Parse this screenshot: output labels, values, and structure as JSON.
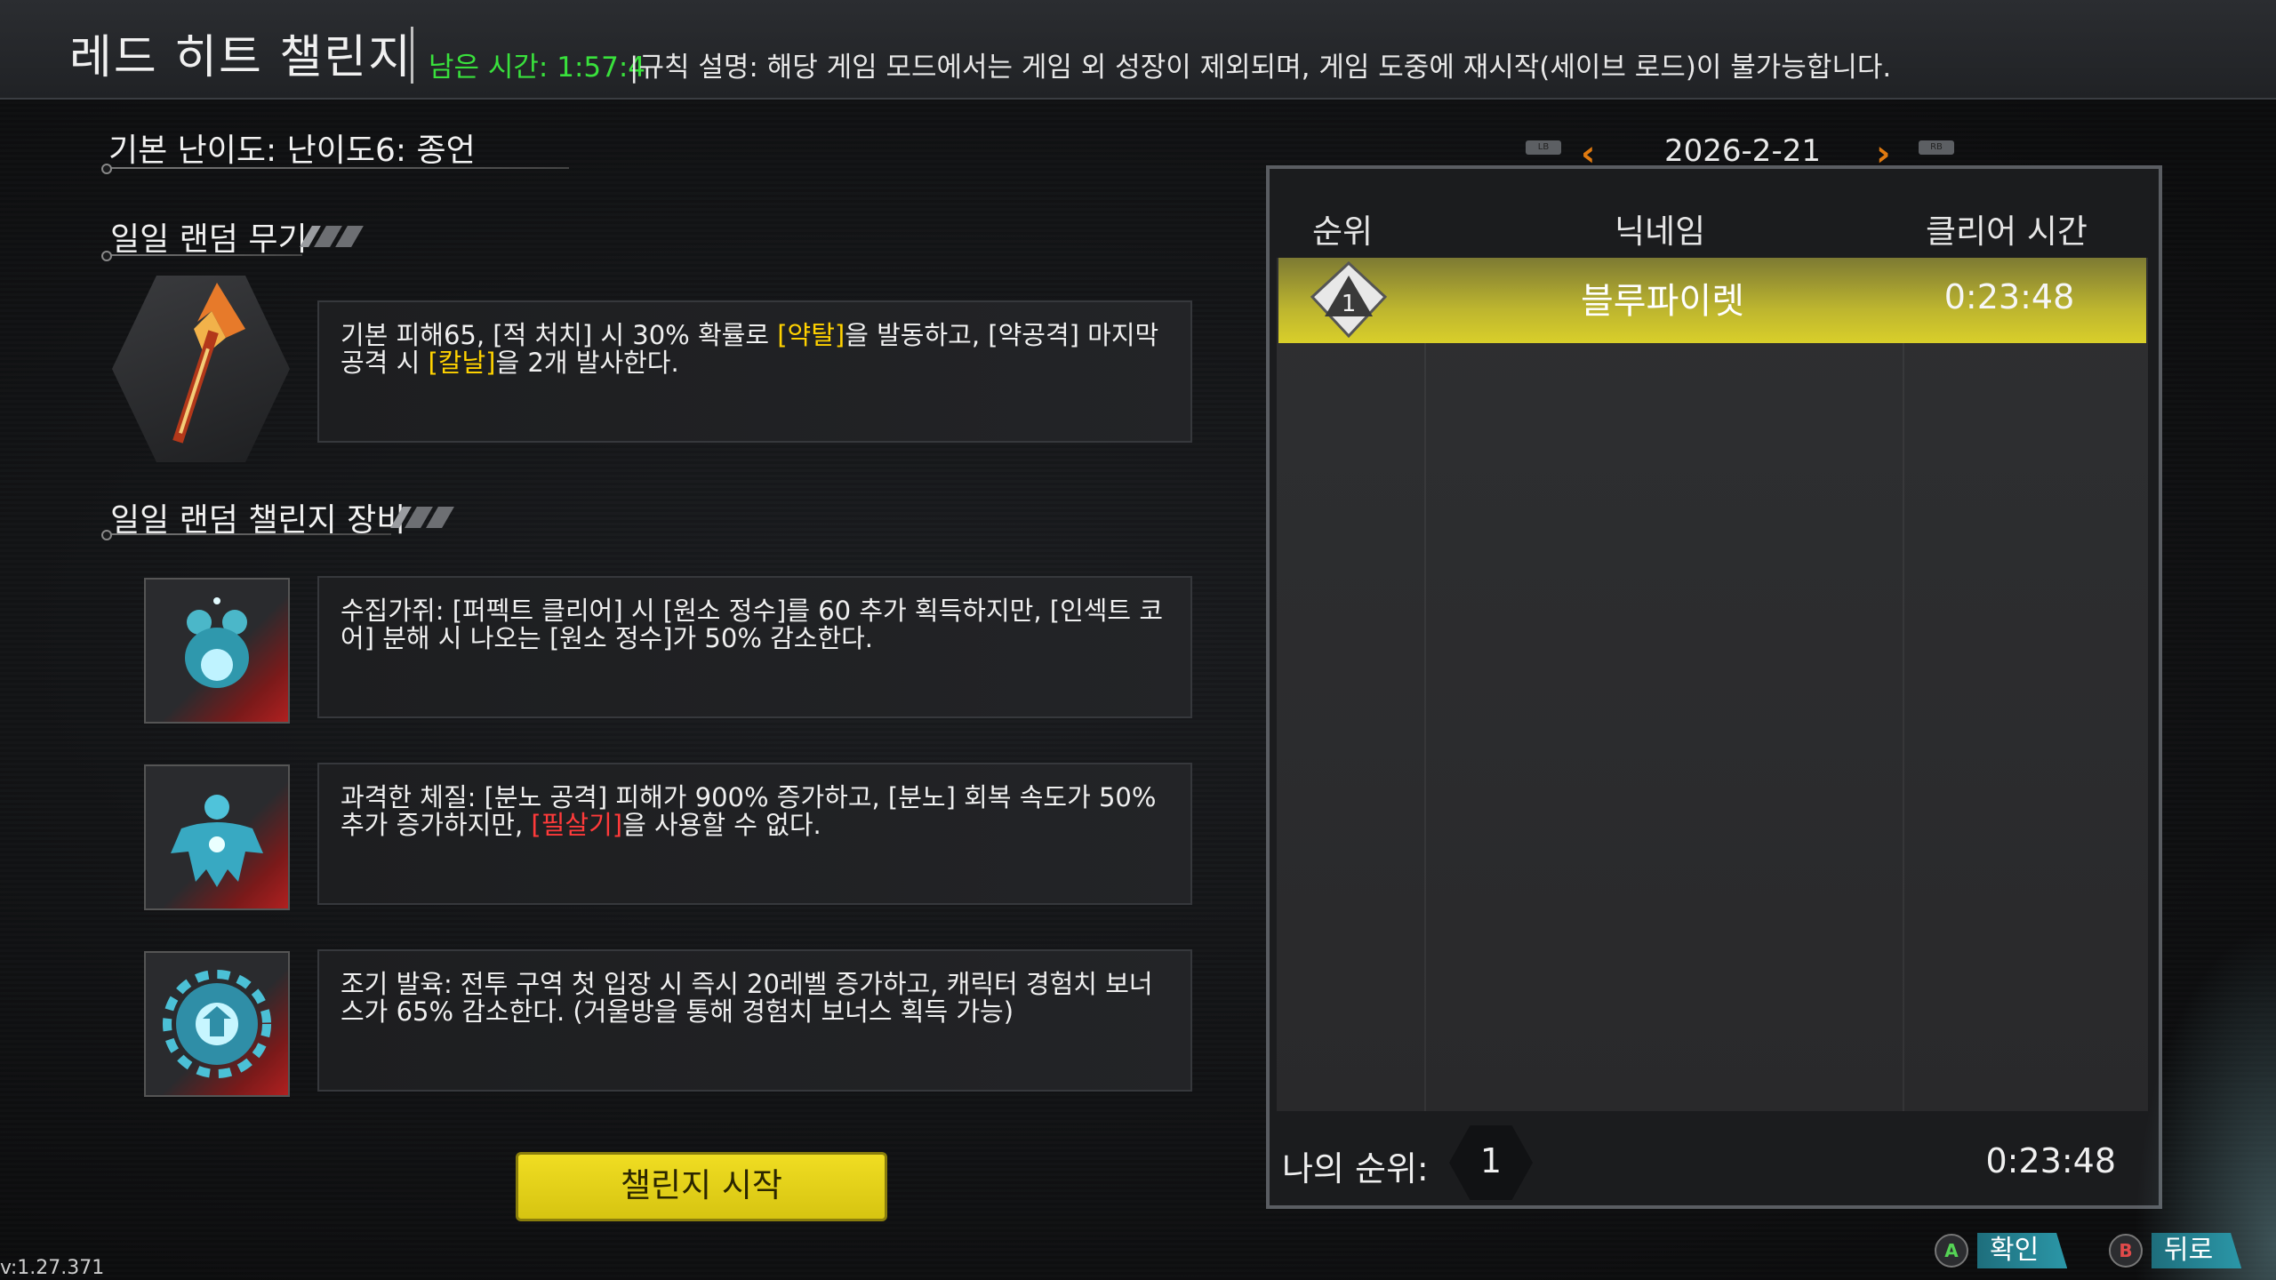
{
  "header": {
    "title": "레드 히트 챌린지",
    "timer": "남은 시간: 1:57:4",
    "rules": "|규칙 설명: 해당 게임 모드에서는 게임 외 성장이 제외되며, 게임 도중에 재시작(세이브 로드)이 불가능합니다."
  },
  "difficulty": "기본 난이도: 난이도6: 종언",
  "weapon_section": {
    "title": "일일 랜덤 무기",
    "desc_parts": [
      "기본 피해65, [적 처치] 시 30% 확률로 ",
      "[약탈]",
      "을 발동하고, [약공격] 마지막 공격 시 ",
      "[칼날]",
      "을 2개 발사한다."
    ]
  },
  "equipment_section": {
    "title": "일일 랜덤 챌린지 장비",
    "items": [
      {
        "icon": "treasure-mouse-icon",
        "desc_parts": [
          "수집가쥐: [퍼펙트 클리어] 시 [원소 정수]를 60 추가 획득하지만, [인섹트 코어] 분해 시 나오는 [원소 정수]가 50% 감소한다."
        ]
      },
      {
        "icon": "muscle-figure-icon",
        "desc_parts": [
          "과격한 체질: [분노 공격] 피해가 900% 증가하고, [분노] 회복 속도가 50% 추가 증가하지만, ",
          "[필살기]",
          "을 사용할 수 없다."
        ]
      },
      {
        "icon": "gear-growth-icon",
        "desc_parts": [
          "조기 발육: 전투 구역 첫 입장 시 즉시 20레벨 증가하고, 캐릭터 경험치 보너스가 65% 감소한다. (거울방을 통해 경험치 보너스 획득 가능)"
        ]
      }
    ]
  },
  "start_button": "챌린지 시작",
  "version": "v:1.27.371",
  "leaderboard": {
    "lb_label": "LB",
    "rb_label": "RB",
    "date": "2026-2-21",
    "headers": {
      "rank": "순위",
      "nickname": "닉네임",
      "clear_time": "클리어 시간"
    },
    "rows": [
      {
        "rank": "1",
        "nickname": "블루파이렛",
        "time": "0:23:48"
      }
    ],
    "my_rank_label": "나의 순위:",
    "my_rank": "1",
    "my_time": "0:23:48"
  },
  "hints": {
    "confirm_key": "A",
    "confirm": "확인",
    "back_key": "B",
    "back": "뒤로"
  },
  "colors": {
    "accent_yellow": "#ffd200",
    "accent_red": "#ff3a3a",
    "timer_green": "#39e13c",
    "button_yellow": "#e8d61a",
    "hint_teal": "#2b97a8"
  }
}
